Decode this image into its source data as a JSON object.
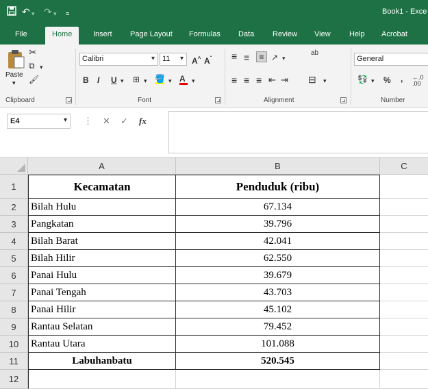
{
  "app": {
    "window_title": "Book1 - Exce"
  },
  "quick_access": {
    "save_icon": "save-icon",
    "undo_icon": "undo-icon",
    "redo_icon": "redo-icon",
    "customize_icon": "customize-icon"
  },
  "tabs": [
    {
      "label": "File"
    },
    {
      "label": "Home"
    },
    {
      "label": "Insert"
    },
    {
      "label": "Page Layout"
    },
    {
      "label": "Formulas"
    },
    {
      "label": "Data"
    },
    {
      "label": "Review"
    },
    {
      "label": "View"
    },
    {
      "label": "Help"
    },
    {
      "label": "Acrobat"
    }
  ],
  "ribbon": {
    "clipboard": {
      "label": "Clipboard",
      "paste_label": "Paste"
    },
    "font": {
      "label": "Font",
      "font_name": "Calibri",
      "font_size": "11",
      "bold": "B",
      "italic": "I",
      "underline": "U",
      "grow": "A",
      "shrink": "A",
      "font_color_letter": "A"
    },
    "alignment": {
      "label": "Alignment",
      "wrap_icon": "ab"
    },
    "number": {
      "label": "Number",
      "format": "General",
      "percent": "%",
      "comma": ","
    }
  },
  "formula_bar": {
    "name_box": "E4",
    "fx": "fx",
    "value": ""
  },
  "colors": {
    "excel_green": "#1e7145",
    "ribbon_bg": "#f3f3f3",
    "header_bg": "#e6e6e6"
  },
  "sheet": {
    "columns": [
      "A",
      "B",
      "C"
    ],
    "rows": [
      {
        "n": "1",
        "a": "Kecamatan",
        "b": "Penduduk (ribu)"
      },
      {
        "n": "2",
        "a": "Bilah Hulu",
        "b": "67.134"
      },
      {
        "n": "3",
        "a": "Pangkatan",
        "b": "39.796"
      },
      {
        "n": "4",
        "a": "Bilah Barat",
        "b": "42.041"
      },
      {
        "n": "5",
        "a": "Bilah Hilir",
        "b": "62.550"
      },
      {
        "n": "6",
        "a": "Panai Hulu",
        "b": "39.679"
      },
      {
        "n": "7",
        "a": "Panai Tengah",
        "b": "43.703"
      },
      {
        "n": "8",
        "a": "Panai Hilir",
        "b": "45.102"
      },
      {
        "n": "9",
        "a": "Rantau Selatan",
        "b": "79.452"
      },
      {
        "n": "10",
        "a": "Rantau Utara",
        "b": "101.088"
      },
      {
        "n": "11",
        "a": "Labuhanbatu",
        "b": "520.545"
      },
      {
        "n": "12",
        "a": "",
        "b": ""
      }
    ]
  }
}
